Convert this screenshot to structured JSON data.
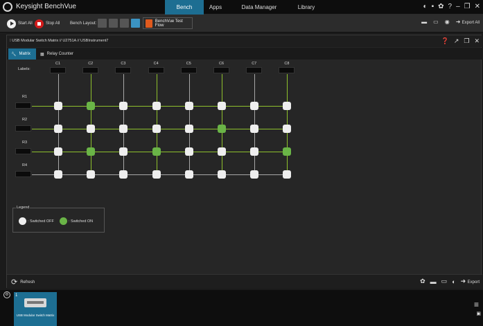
{
  "app": {
    "title": "Keysight BenchVue"
  },
  "nav": {
    "tabs": [
      "Bench",
      "Apps",
      "Data Manager",
      "Library"
    ],
    "active": "Bench"
  },
  "top_icons": [
    "notifications-icon",
    "chat-icon",
    "gear-icon",
    "help-icon",
    "minimize-icon",
    "restore-icon",
    "close-icon"
  ],
  "toolbar": {
    "start_all": "Start All",
    "stop_all": "Stop All",
    "bench_layout_label": "Bench Layout:",
    "test_flow": "BenchVue Test Flow",
    "export_all": "Export All"
  },
  "panel": {
    "title": "USB Modular Switch Matrix // U2751A // USBInstrument7",
    "tabs": [
      "Matrix",
      "Relay Counter"
    ],
    "active_tab": "Matrix"
  },
  "matrix": {
    "labels_heading": "Labels:",
    "columns": [
      "C1",
      "C2",
      "C3",
      "C4",
      "C5",
      "C6",
      "C7",
      "C8"
    ],
    "rows": [
      "R1",
      "R2",
      "R3",
      "R4"
    ],
    "state": [
      [
        0,
        1,
        0,
        0,
        0,
        0,
        0,
        0
      ],
      [
        0,
        0,
        0,
        0,
        0,
        1,
        0,
        0
      ],
      [
        0,
        1,
        0,
        1,
        0,
        0,
        0,
        1
      ],
      [
        0,
        0,
        0,
        0,
        0,
        0,
        0,
        0
      ]
    ]
  },
  "legend": {
    "title": "Legend",
    "off": ": Switched OFF",
    "on": ": Switched ON"
  },
  "footer": {
    "refresh": "Refresh",
    "export": "Export"
  },
  "tray": {
    "card_number": "1",
    "card_label": "USB Modular Switch Matrix"
  },
  "colors": {
    "accent": "#1d6e92",
    "relay_on": "#6ab447",
    "relay_off": "#eeeeee",
    "line_on": "#8fc22c",
    "stop": "#d21b1b"
  }
}
